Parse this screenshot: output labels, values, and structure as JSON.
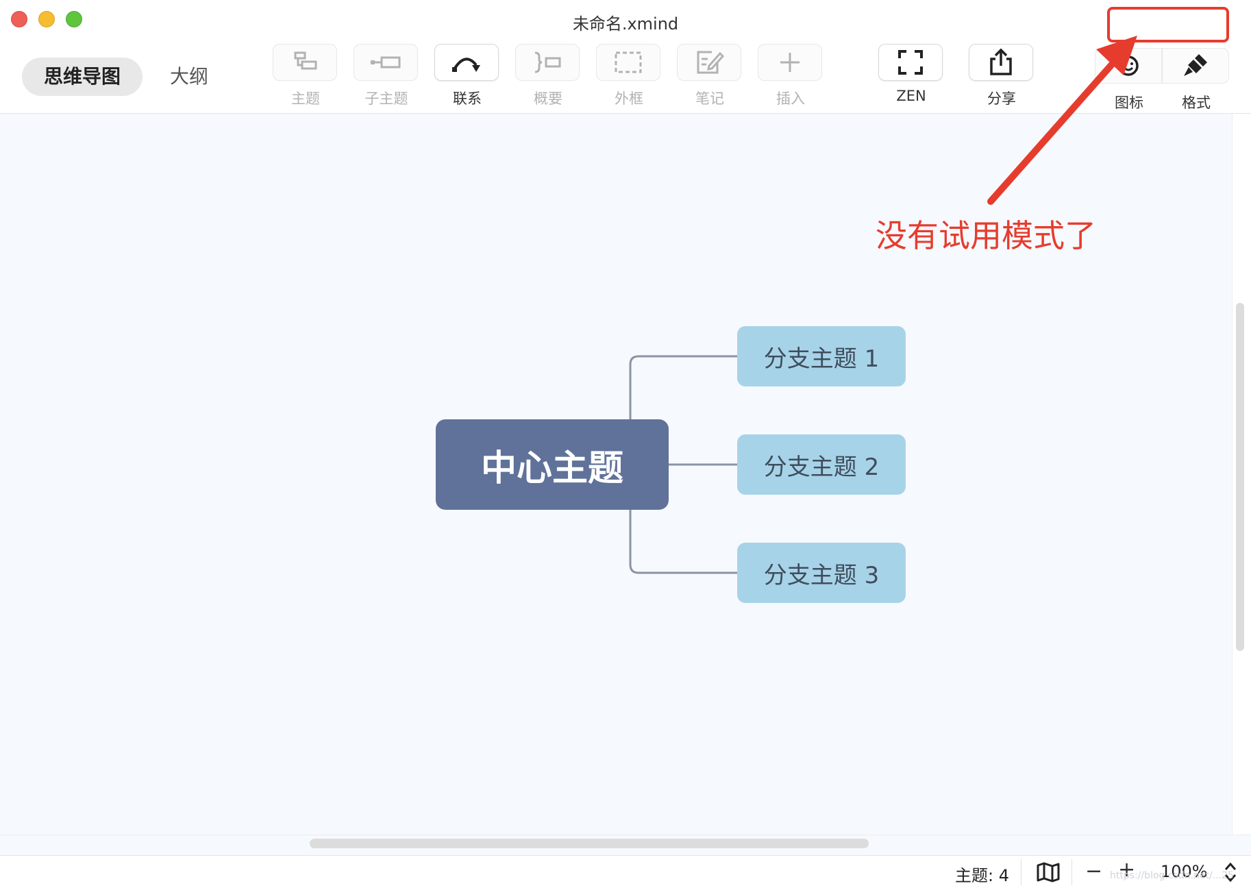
{
  "window": {
    "title": "未命名.xmind"
  },
  "view_tabs": {
    "mindmap": "思维导图",
    "outline": "大纲"
  },
  "toolbar": {
    "topic": "主题",
    "subtopic": "子主题",
    "relationship": "联系",
    "summary": "概要",
    "boundary": "外框",
    "notes": "笔记",
    "insert": "插入",
    "zen": "ZEN",
    "share": "分享",
    "icon_panel": "图标",
    "format_panel": "格式"
  },
  "mindmap": {
    "central": "中心主题",
    "branches": [
      "分支主题 1",
      "分支主题 2",
      "分支主题 3"
    ]
  },
  "annotation": {
    "text": "没有试用模式了",
    "color": "#e63c2e"
  },
  "statusbar": {
    "topic_count": "主题: 4",
    "zoom_out": "−",
    "zoom_in": "+",
    "zoom_level": "100%",
    "watermark": "https://blog.csdn.net/...25"
  },
  "colors": {
    "central_fill": "#607299",
    "branch_fill": "#a7d3e8",
    "connector": "#8a94a6",
    "canvas": "#f6f9fd"
  }
}
